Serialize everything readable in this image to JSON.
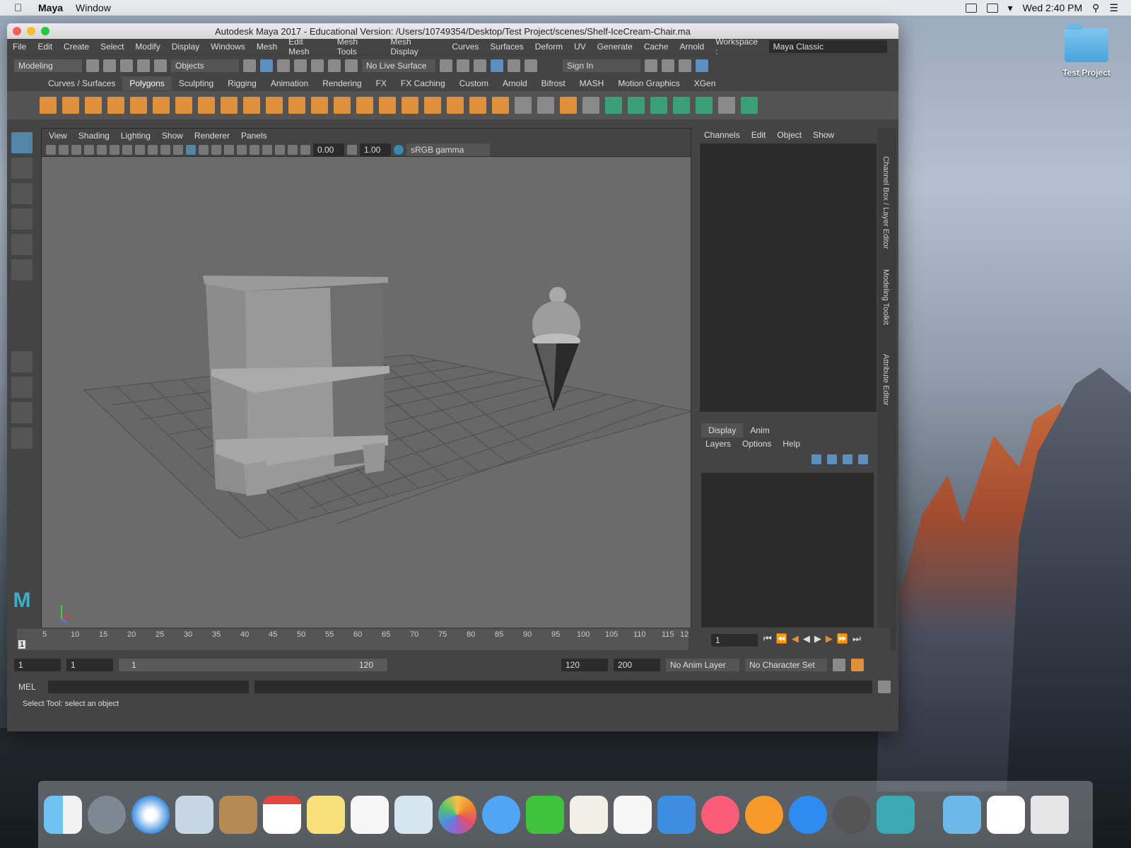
{
  "menubar": {
    "app": "Maya",
    "items": [
      "Window"
    ],
    "clock": "Wed 2:40 PM"
  },
  "desktop": {
    "folder_label": "Test Project"
  },
  "window": {
    "title": "Autodesk Maya 2017 - Educational Version: /Users/10749354/Desktop/Test Project/scenes/Shelf-IceCream-Chair.ma"
  },
  "main_menu": [
    "File",
    "Edit",
    "Create",
    "Select",
    "Modify",
    "Display",
    "Windows",
    "Mesh",
    "Edit Mesh",
    "Mesh Tools",
    "Mesh Display",
    "Curves",
    "Surfaces",
    "Deform",
    "UV",
    "Generate",
    "Cache",
    "Arnold"
  ],
  "workspace": {
    "label": "Workspace :",
    "value": "Maya Classic"
  },
  "status_line": {
    "mode": "Modeling",
    "objects": "Objects",
    "live_surface": "No Live Surface",
    "sign_in": "Sign In"
  },
  "shelf_tabs": [
    "Curves / Surfaces",
    "Polygons",
    "Sculpting",
    "Rigging",
    "Animation",
    "Rendering",
    "FX",
    "FX Caching",
    "Custom",
    "Arnold",
    "Bifrost",
    "MASH",
    "Motion Graphics",
    "XGen"
  ],
  "shelf_active": "Polygons",
  "panel_menu": [
    "View",
    "Shading",
    "Lighting",
    "Show",
    "Renderer",
    "Panels"
  ],
  "panel_toolbar": {
    "exposure": "0.00",
    "gamma": "1.00",
    "colorspace": "sRGB gamma"
  },
  "viewport": {
    "camera": "persp"
  },
  "channel_menu": [
    "Channels",
    "Edit",
    "Object",
    "Show"
  ],
  "layer_tabs": [
    "Display",
    "Anim"
  ],
  "layer_menu": [
    "Layers",
    "Options",
    "Help"
  ],
  "side_tabs": [
    "Channel Box / Layer Editor",
    "Modeling Toolkit",
    "Attribute Editor"
  ],
  "time_ticks": [
    "5",
    "10",
    "15",
    "20",
    "25",
    "30",
    "35",
    "40",
    "45",
    "50",
    "55",
    "60",
    "65",
    "70",
    "75",
    "80",
    "85",
    "90",
    "95",
    "100",
    "105",
    "110",
    "115",
    "12"
  ],
  "current_frame_marker": "1",
  "current_frame": "1",
  "range": {
    "start": "1",
    "start2": "1",
    "slider_start": "1",
    "slider_end": "120",
    "end": "120",
    "end2": "200",
    "anim_layer": "No Anim Layer",
    "char_set": "No Character Set"
  },
  "cmd": {
    "label": "MEL"
  },
  "help_line": "Select Tool: select an object"
}
